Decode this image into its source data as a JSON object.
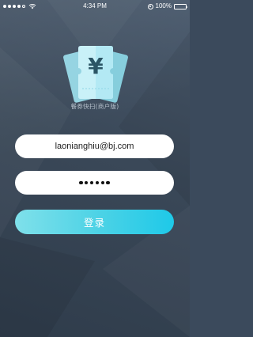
{
  "status_bar": {
    "time": "4:34 PM",
    "battery_percent": "100%",
    "signal_bars_filled": 4,
    "signal_bars_total": 5
  },
  "app": {
    "subtitle": "餐券快扫(商户版)",
    "logo_symbol": "¥",
    "logo_icon": "ticket-yen-icon"
  },
  "login": {
    "email_value": "laonianghiu@bj.com",
    "password_dot_count": 6,
    "login_button_label": "登录"
  },
  "colors": {
    "background": "#3b4a5c",
    "button_gradient_start": "#7fe0ea",
    "button_gradient_end": "#1ec9e8",
    "ticket_light": "#bfeef7",
    "ticket_dark": "#67cfe4"
  }
}
